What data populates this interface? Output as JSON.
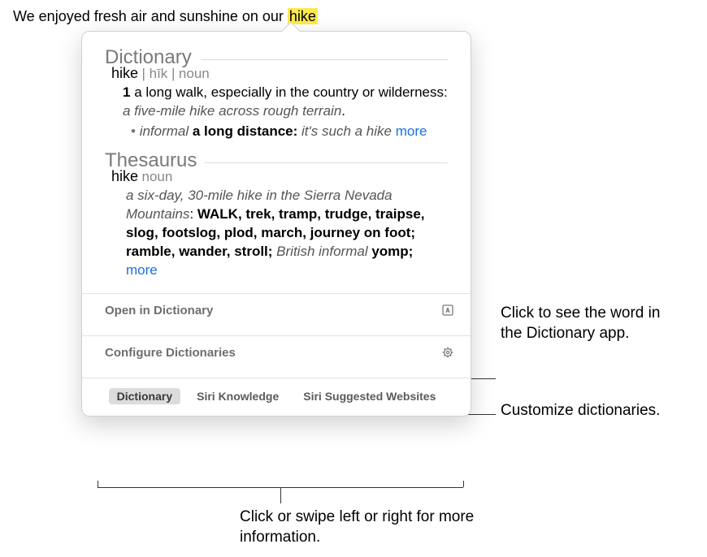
{
  "sentence": {
    "before": "We enjoyed fresh air and sunshine on our ",
    "highlighted": "hike"
  },
  "popover": {
    "dictionary": {
      "section_label": "Dictionary",
      "headword": "hike",
      "pronunciation": "| hīk |",
      "pos": "noun",
      "sense_number": "1",
      "definition": "a long walk, especially in the country or wilderness: ",
      "example": "a five-mile hike across rough terrain",
      "period": ".",
      "sub_register": "informal",
      "sub_definition": " a long distance: ",
      "sub_example": "it's such a hike ",
      "more_label": "more"
    },
    "thesaurus": {
      "section_label": "Thesaurus",
      "headword": "hike",
      "pos": "noun",
      "example": "a six-day, 30-mile hike in the Sierra Nevada Mountains",
      "colon": ": ",
      "syn_first": "WALK",
      "syn_rest": ", trek, tramp, trudge, traipse, slog, footslog, plod, march, journey on foot; ramble, wander, stroll; ",
      "syn_reg": "British informal",
      "syn_last": " yomp; ",
      "more_label": "more"
    },
    "actions": {
      "open_label": "Open in Dictionary",
      "configure_label": "Configure Dictionaries"
    },
    "tabs": {
      "dictionary": "Dictionary",
      "siri_knowledge": "Siri Knowledge",
      "siri_websites": "Siri Suggested Websites"
    }
  },
  "callouts": {
    "open": "Click to see the word in the Dictionary app.",
    "configure": "Customize dictionaries.",
    "swipe": "Click or swipe left or right for more information."
  }
}
